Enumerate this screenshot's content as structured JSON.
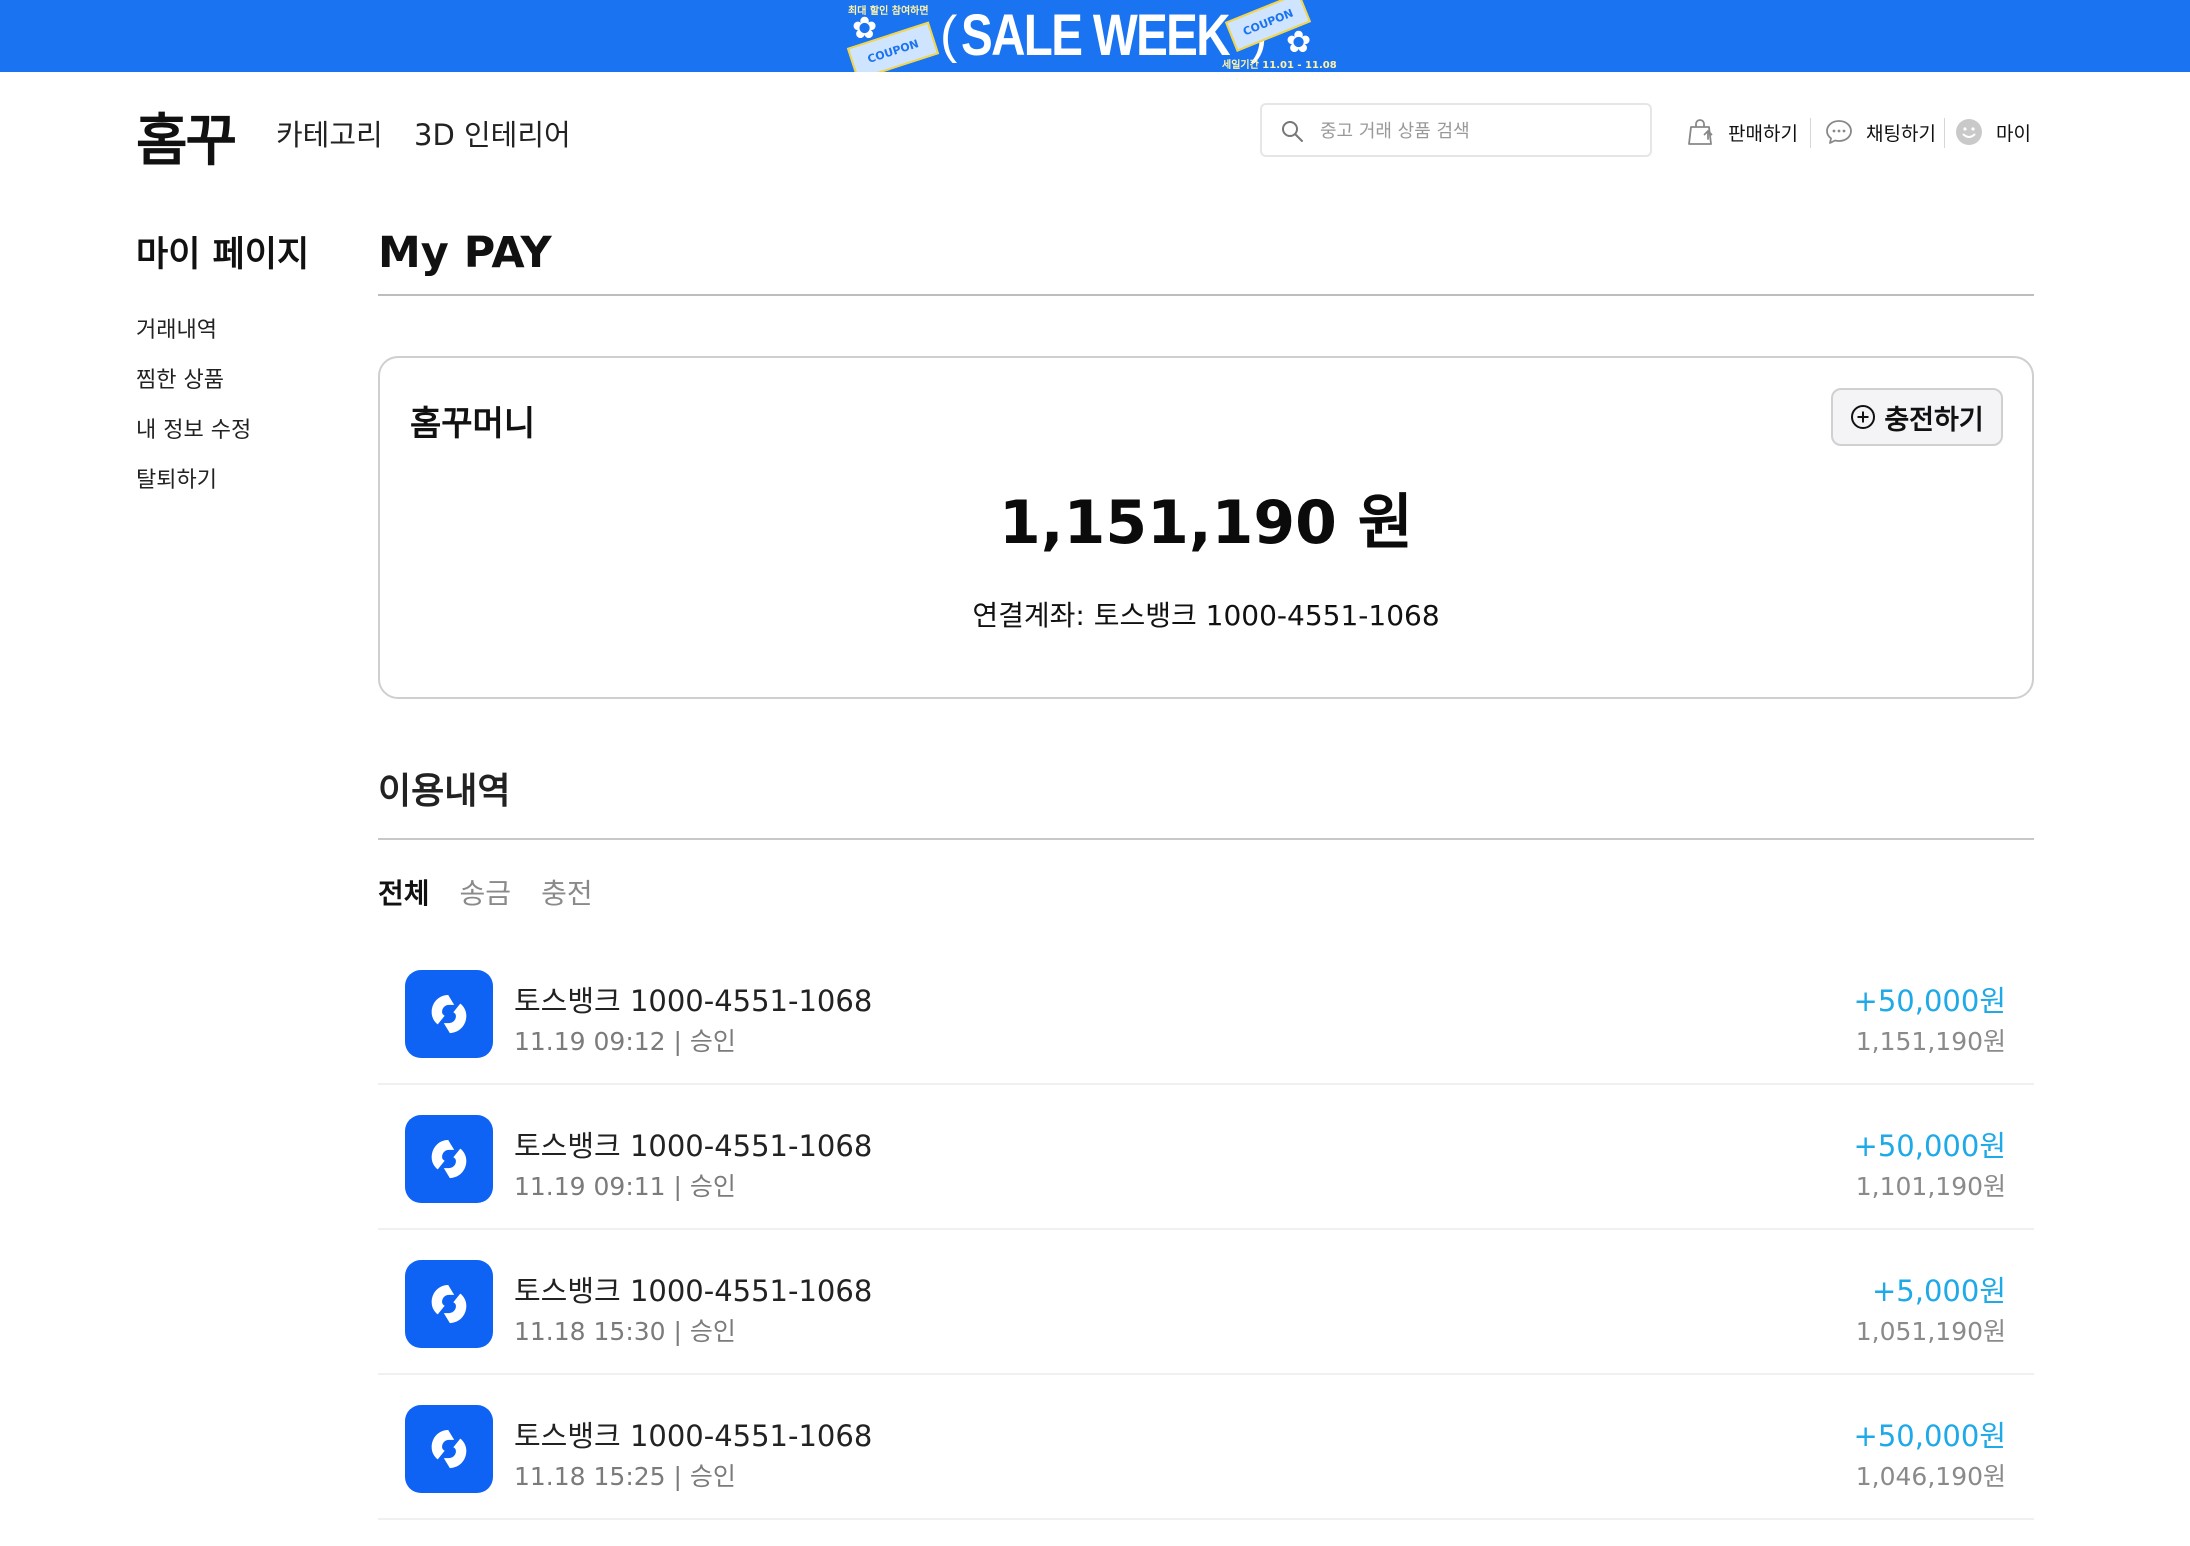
{
  "banner": {
    "sale_text": "SALE WEEK",
    "paren_open": "(",
    "paren_close": ")",
    "coupon_label": "COUPON",
    "top_tag": "최대 할인 참여하면",
    "bottom_tag": "세일기간 11.01 - 11.08",
    "color": "#1a73f0"
  },
  "header": {
    "logo": "홈꾸",
    "nav": [
      "카테고리",
      "3D 인테리어"
    ],
    "search_placeholder": "중고 거래 상품 검색",
    "links": {
      "sell": "판매하기",
      "chat": "채팅하기",
      "my": "마이"
    }
  },
  "sidebar": {
    "title": "마이 페이지",
    "items": [
      "거래내역",
      "찜한 상품",
      "내 정보 수정",
      "탈퇴하기"
    ]
  },
  "main": {
    "title": "My PAY",
    "money_card": {
      "title": "홈꾸머니",
      "charge_button": "충전하기",
      "balance": "1,151,190 원",
      "account": "연결계좌: 토스뱅크 1000-4551-1068"
    },
    "history": {
      "title": "이용내역",
      "tabs": [
        "전체",
        "송금",
        "충전"
      ],
      "active_tab": "전체",
      "transactions": [
        {
          "name": "토스뱅크 1000-4551-1068",
          "meta": "11.19 09:12 | 승인",
          "amount": "+50,000원",
          "balance": "1,151,190원"
        },
        {
          "name": "토스뱅크 1000-4551-1068",
          "meta": "11.19 09:11 | 승인",
          "amount": "+50,000원",
          "balance": "1,101,190원"
        },
        {
          "name": "토스뱅크 1000-4551-1068",
          "meta": "11.18 15:30 | 승인",
          "amount": "+5,000원",
          "balance": "1,051,190원"
        },
        {
          "name": "토스뱅크 1000-4551-1068",
          "meta": "11.18 15:25 | 승인",
          "amount": "+50,000원",
          "balance": "1,046,190원"
        }
      ]
    }
  },
  "colors": {
    "accent": "#0e63f4",
    "amount": "#1ea9e8",
    "banner": "#1a73f0"
  },
  "icons": {
    "transaction": "toss-icon",
    "search": "search-icon",
    "sell": "shopping-bag-icon",
    "chat": "chat-bubble-icon",
    "my": "smiley-icon",
    "charge": "plus-circle-icon"
  }
}
